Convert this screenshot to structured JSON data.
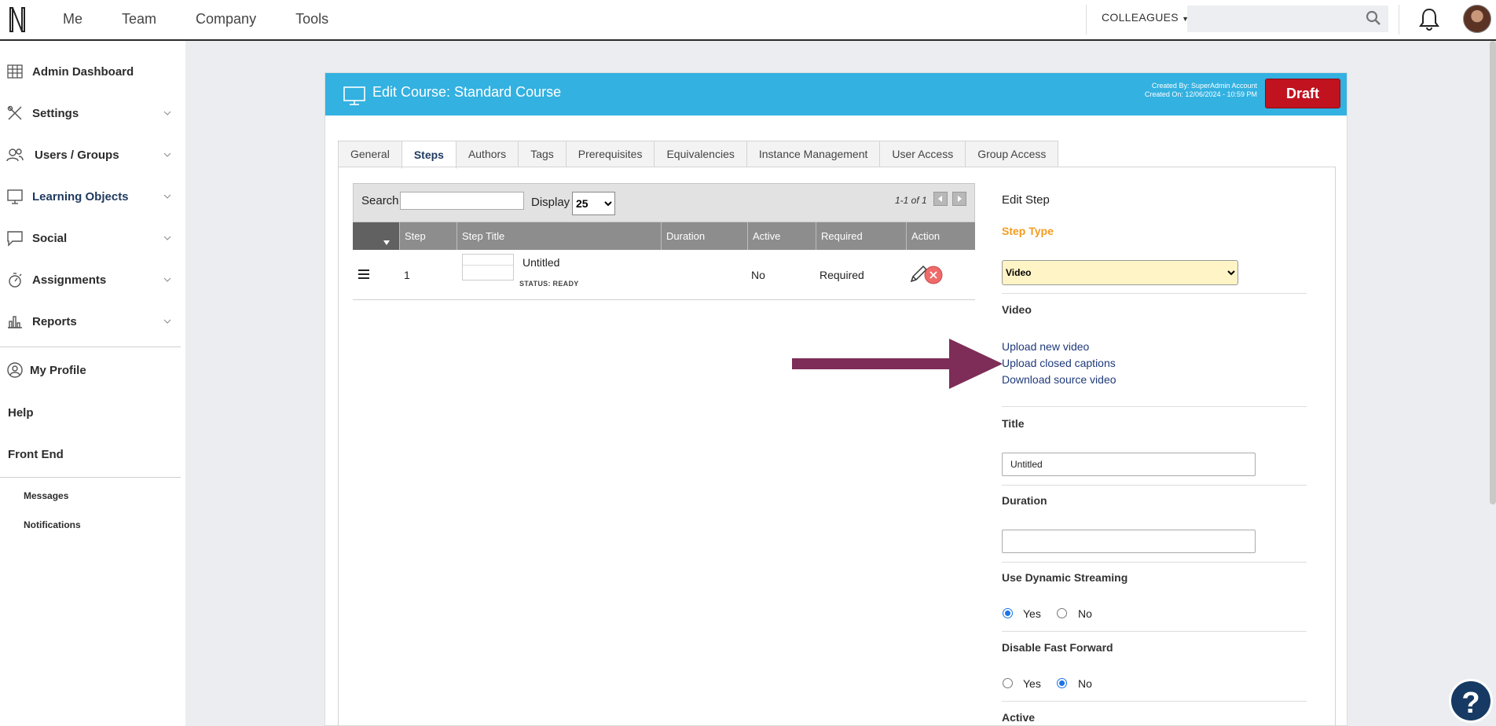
{
  "topnav": {
    "items": [
      "Me",
      "Team",
      "Company",
      "Tools"
    ],
    "colleagues_label": "COLLEAGUES",
    "search_placeholder": ""
  },
  "sidebar": {
    "items": [
      {
        "label": "Admin Dashboard",
        "icon": "grid-icon"
      },
      {
        "label": "Settings",
        "icon": "tools-icon"
      },
      {
        "label": "Users / Groups",
        "icon": "users-icon"
      },
      {
        "label": "Learning Objects",
        "icon": "monitor-icon"
      },
      {
        "label": "Social",
        "icon": "chat-icon"
      },
      {
        "label": "Assignments",
        "icon": "stopwatch-icon"
      },
      {
        "label": "Reports",
        "icon": "bar-chart-icon"
      }
    ],
    "my_profile": "My Profile",
    "help": "Help",
    "front_end": "Front End",
    "messages": "Messages",
    "notifications": "Notifications"
  },
  "header": {
    "title": "Edit Course: Standard Course",
    "created_by": "Created By: SuperAdmin Account",
    "created_on": "Created On: 12/06/2024 - 10:59 PM",
    "status_button": "Draft"
  },
  "tabs": [
    "General",
    "Steps",
    "Authors",
    "Tags",
    "Prerequisites",
    "Equivalencies",
    "Instance Management",
    "User Access",
    "Group Access"
  ],
  "active_tab": "Steps",
  "steps_table": {
    "search_label": "Search",
    "search_value": "",
    "display_label": "Display",
    "display_value": "25",
    "count": "1-1 of 1",
    "columns": [
      "Step",
      "Step Title",
      "Duration",
      "Active",
      "Required",
      "Action"
    ],
    "rows": [
      {
        "step": "1",
        "title": "Untitled",
        "status": "STATUS: READY",
        "duration": "",
        "active": "No",
        "required": "Required"
      }
    ]
  },
  "edit_step": {
    "heading": "Edit Step",
    "step_type_label": "Step Type",
    "step_type_value": "Video",
    "video_label": "Video",
    "links": [
      "Upload new video",
      "Upload closed captions",
      "Download source video"
    ],
    "title_label": "Title",
    "title_value": "Untitled",
    "duration_label": "Duration",
    "duration_value": "",
    "dynamic_streaming_label": "Use Dynamic Streaming",
    "dynamic_streaming": "Yes",
    "disable_ff_label": "Disable Fast Forward",
    "disable_ff": "No",
    "active_label": "Active",
    "yes": "Yes",
    "no": "No"
  },
  "annotation": {
    "arrow_color": "#7d2d57"
  },
  "help_button": "?"
}
